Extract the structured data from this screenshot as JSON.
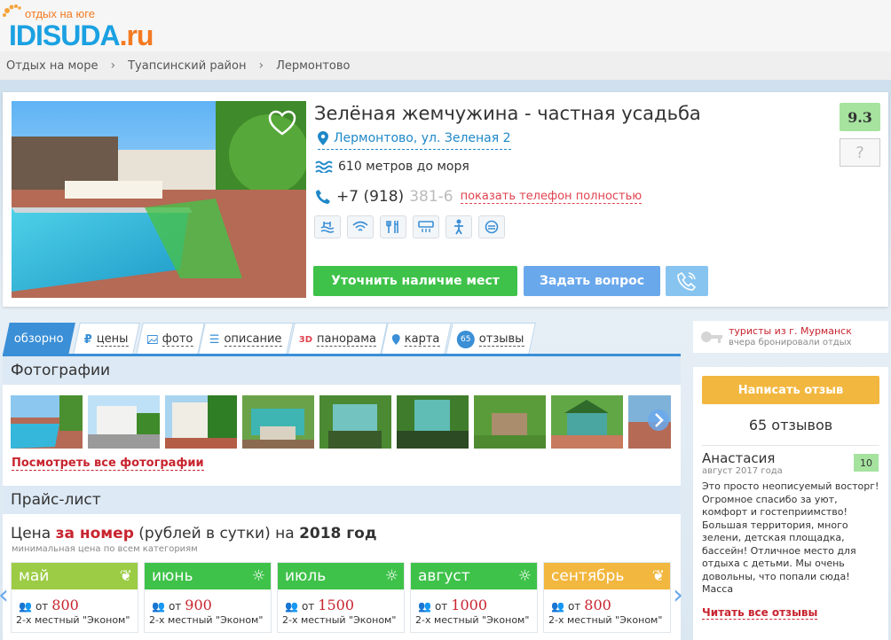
{
  "logo": {
    "tagline": "отдых на юге",
    "brand_main": "IDISUDA",
    "brand_tld": ".ru"
  },
  "breadcrumbs": [
    "Отдых на море",
    "Туапсинский район",
    "Лермонтово"
  ],
  "hotel": {
    "title": "Зелёная жемчужина - частная усадьба",
    "address": "Лермонтово, ул. Зеленая 2",
    "sea_distance": "610 метров до моря",
    "phone_visible": "+7 (918) ",
    "phone_hidden": "381-6",
    "show_phone": "показать телефон полностью",
    "score": "9.3",
    "score_unknown": "?",
    "amenities": [
      "pool-icon",
      "wifi-icon",
      "food-icon",
      "ac-icon",
      "kids-icon",
      "transfer-icon"
    ],
    "btn_availability": "Уточнить наличие мест",
    "btn_ask": "Задать вопрос"
  },
  "tabs": [
    {
      "label": "обзорно",
      "icon": "",
      "active": true
    },
    {
      "label": "цены",
      "icon": "ruble-icon"
    },
    {
      "label": "фото",
      "icon": "photo-icon"
    },
    {
      "label": "описание",
      "icon": "list-icon"
    },
    {
      "label": "панорама",
      "icon": "3d-icon",
      "prefix": "3D"
    },
    {
      "label": "карта",
      "icon": "map-pin-icon"
    },
    {
      "label": "отзывы",
      "icon": "reviews-count-icon",
      "prefix": "65"
    }
  ],
  "photos": {
    "heading": "Фотографии",
    "see_all": "Посмотреть все фотографии"
  },
  "pricelist": {
    "heading": "Прайс-лист",
    "title_part1": "Цена ",
    "title_red": "за номер",
    "title_part2": " (рублей в сутки) на ",
    "title_year": "2018 год",
    "subtitle": "минимальная цена по всем категориям",
    "months": [
      {
        "name": "май",
        "from": "от",
        "price": "800",
        "room": "2-х местный \"Эконом\"",
        "color": "#9ccc45",
        "icon": "leaf-icon"
      },
      {
        "name": "июнь",
        "from": "от",
        "price": "900",
        "room": "2-х местный \"Эконом\"",
        "color": "#3fc24a",
        "icon": "sun-icon"
      },
      {
        "name": "июль",
        "from": "от",
        "price": "1500",
        "room": "2-х местный \"Эконом\"",
        "color": "#3fc24a",
        "icon": "sun-icon"
      },
      {
        "name": "август",
        "from": "от",
        "price": "1000",
        "room": "2-х местный \"Эконом\"",
        "color": "#3fc24a",
        "icon": "sun-icon"
      },
      {
        "name": "сентябрь",
        "from": "от",
        "price": "800",
        "room": "2-х местный \"Эконом\"",
        "color": "#f2b73f",
        "icon": "leaf-icon"
      }
    ]
  },
  "sidebar": {
    "note_line1": "туристы из г. Мурманск",
    "note_line2": "вчера бронировали отдых",
    "btn_review": "Написать отзыв",
    "reviews_count": "65 отзывов",
    "review": {
      "name": "Анастасия",
      "date": "август 2017 года",
      "score": "10",
      "text": "Это просто неописуемый восторг! Огромное спасибо за уют, комфорт и гостеприимство! Большая территория, много зелени, детская площадка, бассейн! Отличное место для отдыха с детьми. Мы очень довольны, что попали сюда! Масса"
    },
    "read_all": "Читать все отзывы"
  }
}
